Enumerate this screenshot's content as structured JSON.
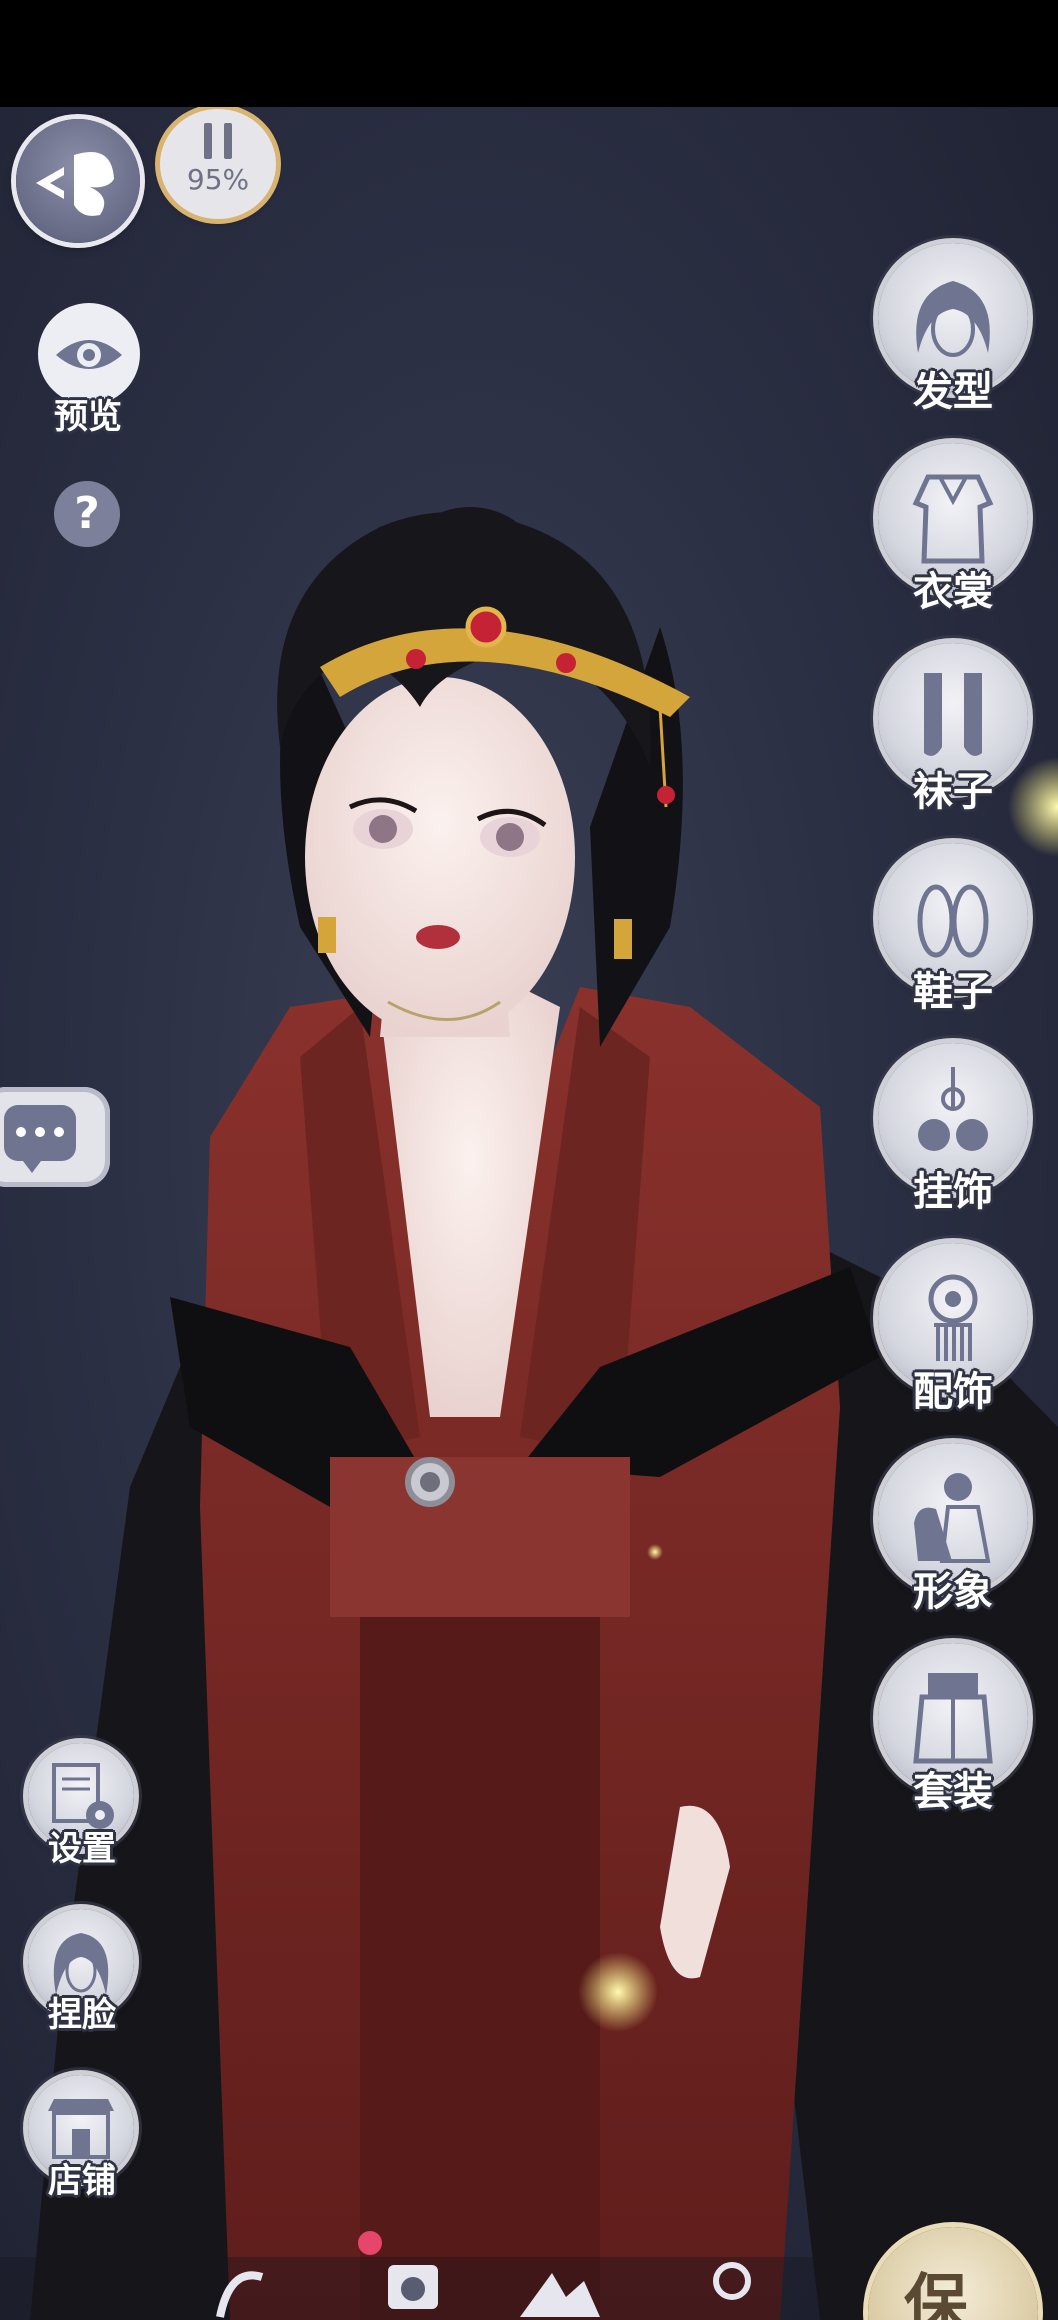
{
  "hud": {
    "pause_percent": "95%",
    "preview_label": "预览",
    "help_glyph": "?"
  },
  "right_menu": [
    {
      "label": "发型",
      "icon": "hairstyle-icon"
    },
    {
      "label": "衣裳",
      "icon": "dress-icon"
    },
    {
      "label": "袜子",
      "icon": "socks-icon"
    },
    {
      "label": "鞋子",
      "icon": "shoes-icon"
    },
    {
      "label": "挂饰",
      "icon": "pendant-icon"
    },
    {
      "label": "配饰",
      "icon": "accessory-icon"
    },
    {
      "label": "形象",
      "icon": "appearance-icon"
    },
    {
      "label": "套装",
      "icon": "outfit-set-icon"
    }
  ],
  "left_menu": [
    {
      "label": "设置",
      "icon": "settings-icon"
    },
    {
      "label": "捏脸",
      "icon": "face-edit-icon"
    },
    {
      "label": "店铺",
      "icon": "shop-icon"
    }
  ],
  "save_label": "保",
  "colors": {
    "background": "#2c3044",
    "robe_red": "#7a2a26",
    "robe_black": "#16161a",
    "button_outline": "#2e3243",
    "gold": "#d4a53a"
  }
}
